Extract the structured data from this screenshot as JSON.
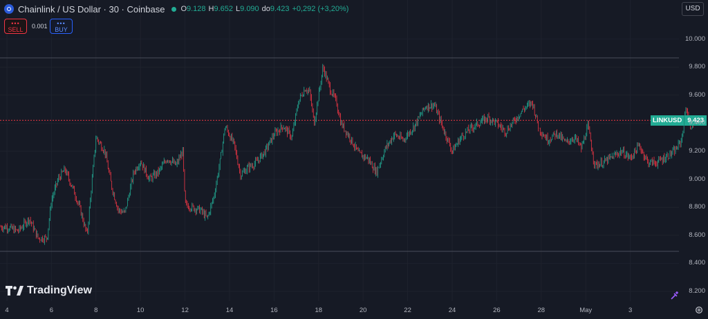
{
  "header": {
    "title": "Chainlink / US Dollar · 30 · Coinbase",
    "ohlc": [
      {
        "k": "O",
        "v": "9.128"
      },
      {
        "k": "H",
        "v": "9.652"
      },
      {
        "k": "L",
        "v": "9.090"
      },
      {
        "k": "do",
        "v": "9.423"
      }
    ],
    "change": "+0,292 (+3,20%)"
  },
  "trade": {
    "sell_dots": "•••",
    "sell_label": "SELL",
    "spread": "0.001",
    "buy_dots": "•••",
    "buy_label": "BUY"
  },
  "currency": "USD",
  "price_tag": {
    "symbol": "LINKUSD",
    "value": "9.423"
  },
  "branding": {
    "name": "TradingView"
  },
  "colors": {
    "up": "#22ab94",
    "down": "#f23645",
    "background": "#161a25",
    "grid": "#1e222d"
  },
  "chart_data": {
    "type": "candlestick",
    "symbol": "LINKUSD",
    "interval": "30",
    "exchange": "Coinbase",
    "y_ticks": [
      "10.000",
      "9.800",
      "9.600",
      "9.400",
      "9.200",
      "9.000",
      "8.800",
      "8.600",
      "8.400",
      "8.200"
    ],
    "ylim": [
      8.15,
      10.15
    ],
    "x_ticks": [
      "4",
      "6",
      "8",
      "10",
      "12",
      "14",
      "16",
      "18",
      "20",
      "22",
      "24",
      "26",
      "28",
      "May",
      "3"
    ],
    "last_price": 9.423,
    "high_line": 9.868,
    "low_line": 8.488,
    "path": [
      [
        0,
        8.66
      ],
      [
        0.5,
        8.63
      ],
      [
        1.0,
        8.72
      ],
      [
        1.4,
        8.58
      ],
      [
        1.8,
        8.58
      ],
      [
        2.0,
        8.85
      ],
      [
        2.3,
        9.0
      ],
      [
        2.6,
        9.07
      ],
      [
        3.0,
        8.92
      ],
      [
        3.3,
        8.78
      ],
      [
        3.6,
        8.6
      ],
      [
        4.0,
        9.3
      ],
      [
        4.4,
        9.2
      ],
      [
        4.7,
        8.95
      ],
      [
        5.0,
        8.78
      ],
      [
        5.3,
        8.76
      ],
      [
        5.7,
        9.05
      ],
      [
        6.0,
        9.13
      ],
      [
        6.4,
        9.0
      ],
      [
        6.8,
        9.05
      ],
      [
        7.2,
        9.15
      ],
      [
        7.6,
        9.1
      ],
      [
        7.9,
        9.2
      ],
      [
        8.0,
        8.82
      ],
      [
        8.3,
        8.8
      ],
      [
        8.7,
        8.78
      ],
      [
        9.0,
        8.72
      ],
      [
        9.3,
        8.88
      ],
      [
        9.6,
        9.15
      ],
      [
        9.8,
        9.38
      ],
      [
        10.2,
        9.25
      ],
      [
        10.5,
        9.03
      ],
      [
        10.8,
        9.08
      ],
      [
        11.2,
        9.12
      ],
      [
        11.6,
        9.2
      ],
      [
        12.0,
        9.32
      ],
      [
        12.4,
        9.38
      ],
      [
        12.8,
        9.3
      ],
      [
        13.1,
        9.56
      ],
      [
        13.4,
        9.65
      ],
      [
        13.6,
        9.62
      ],
      [
        13.8,
        9.4
      ],
      [
        14.2,
        9.8
      ],
      [
        14.5,
        9.65
      ],
      [
        14.8,
        9.55
      ],
      [
        15.0,
        9.4
      ],
      [
        15.4,
        9.3
      ],
      [
        15.8,
        9.18
      ],
      [
        16.2,
        9.15
      ],
      [
        16.6,
        9.05
      ],
      [
        17.0,
        9.22
      ],
      [
        17.4,
        9.32
      ],
      [
        17.8,
        9.28
      ],
      [
        18.3,
        9.38
      ],
      [
        18.8,
        9.52
      ],
      [
        19.2,
        9.53
      ],
      [
        19.6,
        9.36
      ],
      [
        20.0,
        9.2
      ],
      [
        20.4,
        9.3
      ],
      [
        20.8,
        9.36
      ],
      [
        21.2,
        9.4
      ],
      [
        21.6,
        9.44
      ],
      [
        22.0,
        9.4
      ],
      [
        22.4,
        9.34
      ],
      [
        22.8,
        9.42
      ],
      [
        23.2,
        9.5
      ],
      [
        23.6,
        9.55
      ],
      [
        23.9,
        9.36
      ],
      [
        24.3,
        9.28
      ],
      [
        24.7,
        9.33
      ],
      [
        25.1,
        9.26
      ],
      [
        25.5,
        9.3
      ],
      [
        25.8,
        9.22
      ],
      [
        26.1,
        9.38
      ],
      [
        26.4,
        9.1
      ],
      [
        26.8,
        9.12
      ],
      [
        27.2,
        9.16
      ],
      [
        27.6,
        9.2
      ],
      [
        28.0,
        9.15
      ],
      [
        28.4,
        9.24
      ],
      [
        28.8,
        9.12
      ],
      [
        29.2,
        9.12
      ],
      [
        29.6,
        9.16
      ],
      [
        30.0,
        9.2
      ],
      [
        30.3,
        9.28
      ],
      [
        30.5,
        9.52
      ],
      [
        30.7,
        9.38
      ],
      [
        30.9,
        9.42
      ]
    ]
  }
}
